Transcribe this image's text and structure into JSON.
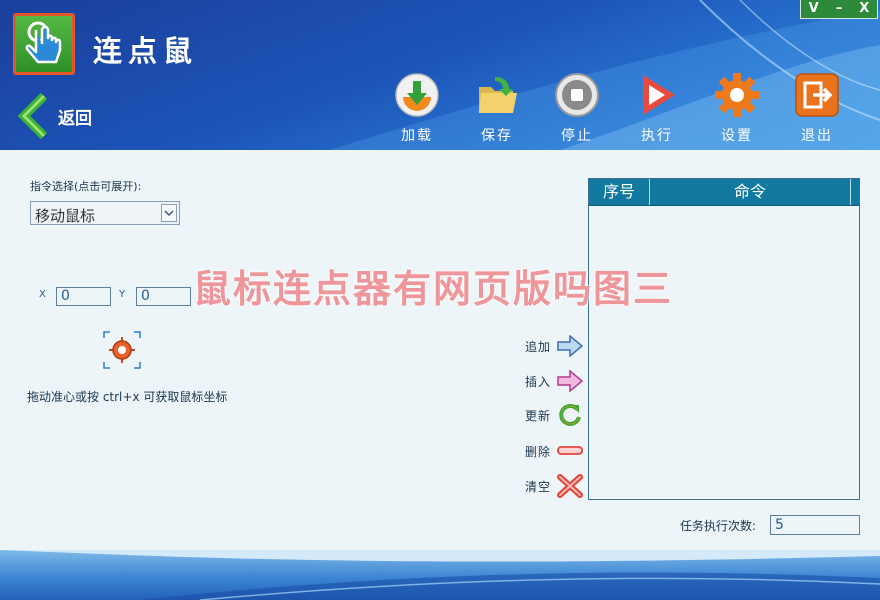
{
  "app": {
    "title": "连点鼠"
  },
  "window_controls": [
    "V",
    "–",
    "X"
  ],
  "nav": {
    "back_label": "返回"
  },
  "toolbar": {
    "add": "加载",
    "save": "保存",
    "stop": "停止",
    "run": "执行",
    "settings": "设置",
    "exit": "退出"
  },
  "command": {
    "select_label": "指令选择(点击可展开):",
    "selected": "移动鼠标"
  },
  "coords": {
    "x_label": "X",
    "x_value": "0",
    "y_label": "Y",
    "y_value": "0"
  },
  "hint": "拖动准心或按 ctrl+x 可获取鼠标坐标",
  "list": {
    "col_seq": "序号",
    "col_cmd": "命令"
  },
  "actions": {
    "add": "追加",
    "insert": "插入",
    "update": "更新",
    "delete": "删除",
    "clear": "清空"
  },
  "task": {
    "label": "任务执行次数:",
    "value": "5"
  },
  "watermark": "鼠标连点器有网页版吗图三",
  "colors": {
    "header": "#1c54b8",
    "accent_green": "#2e8f2a",
    "list_header": "#127aa0",
    "watermark": "#f08f93"
  }
}
